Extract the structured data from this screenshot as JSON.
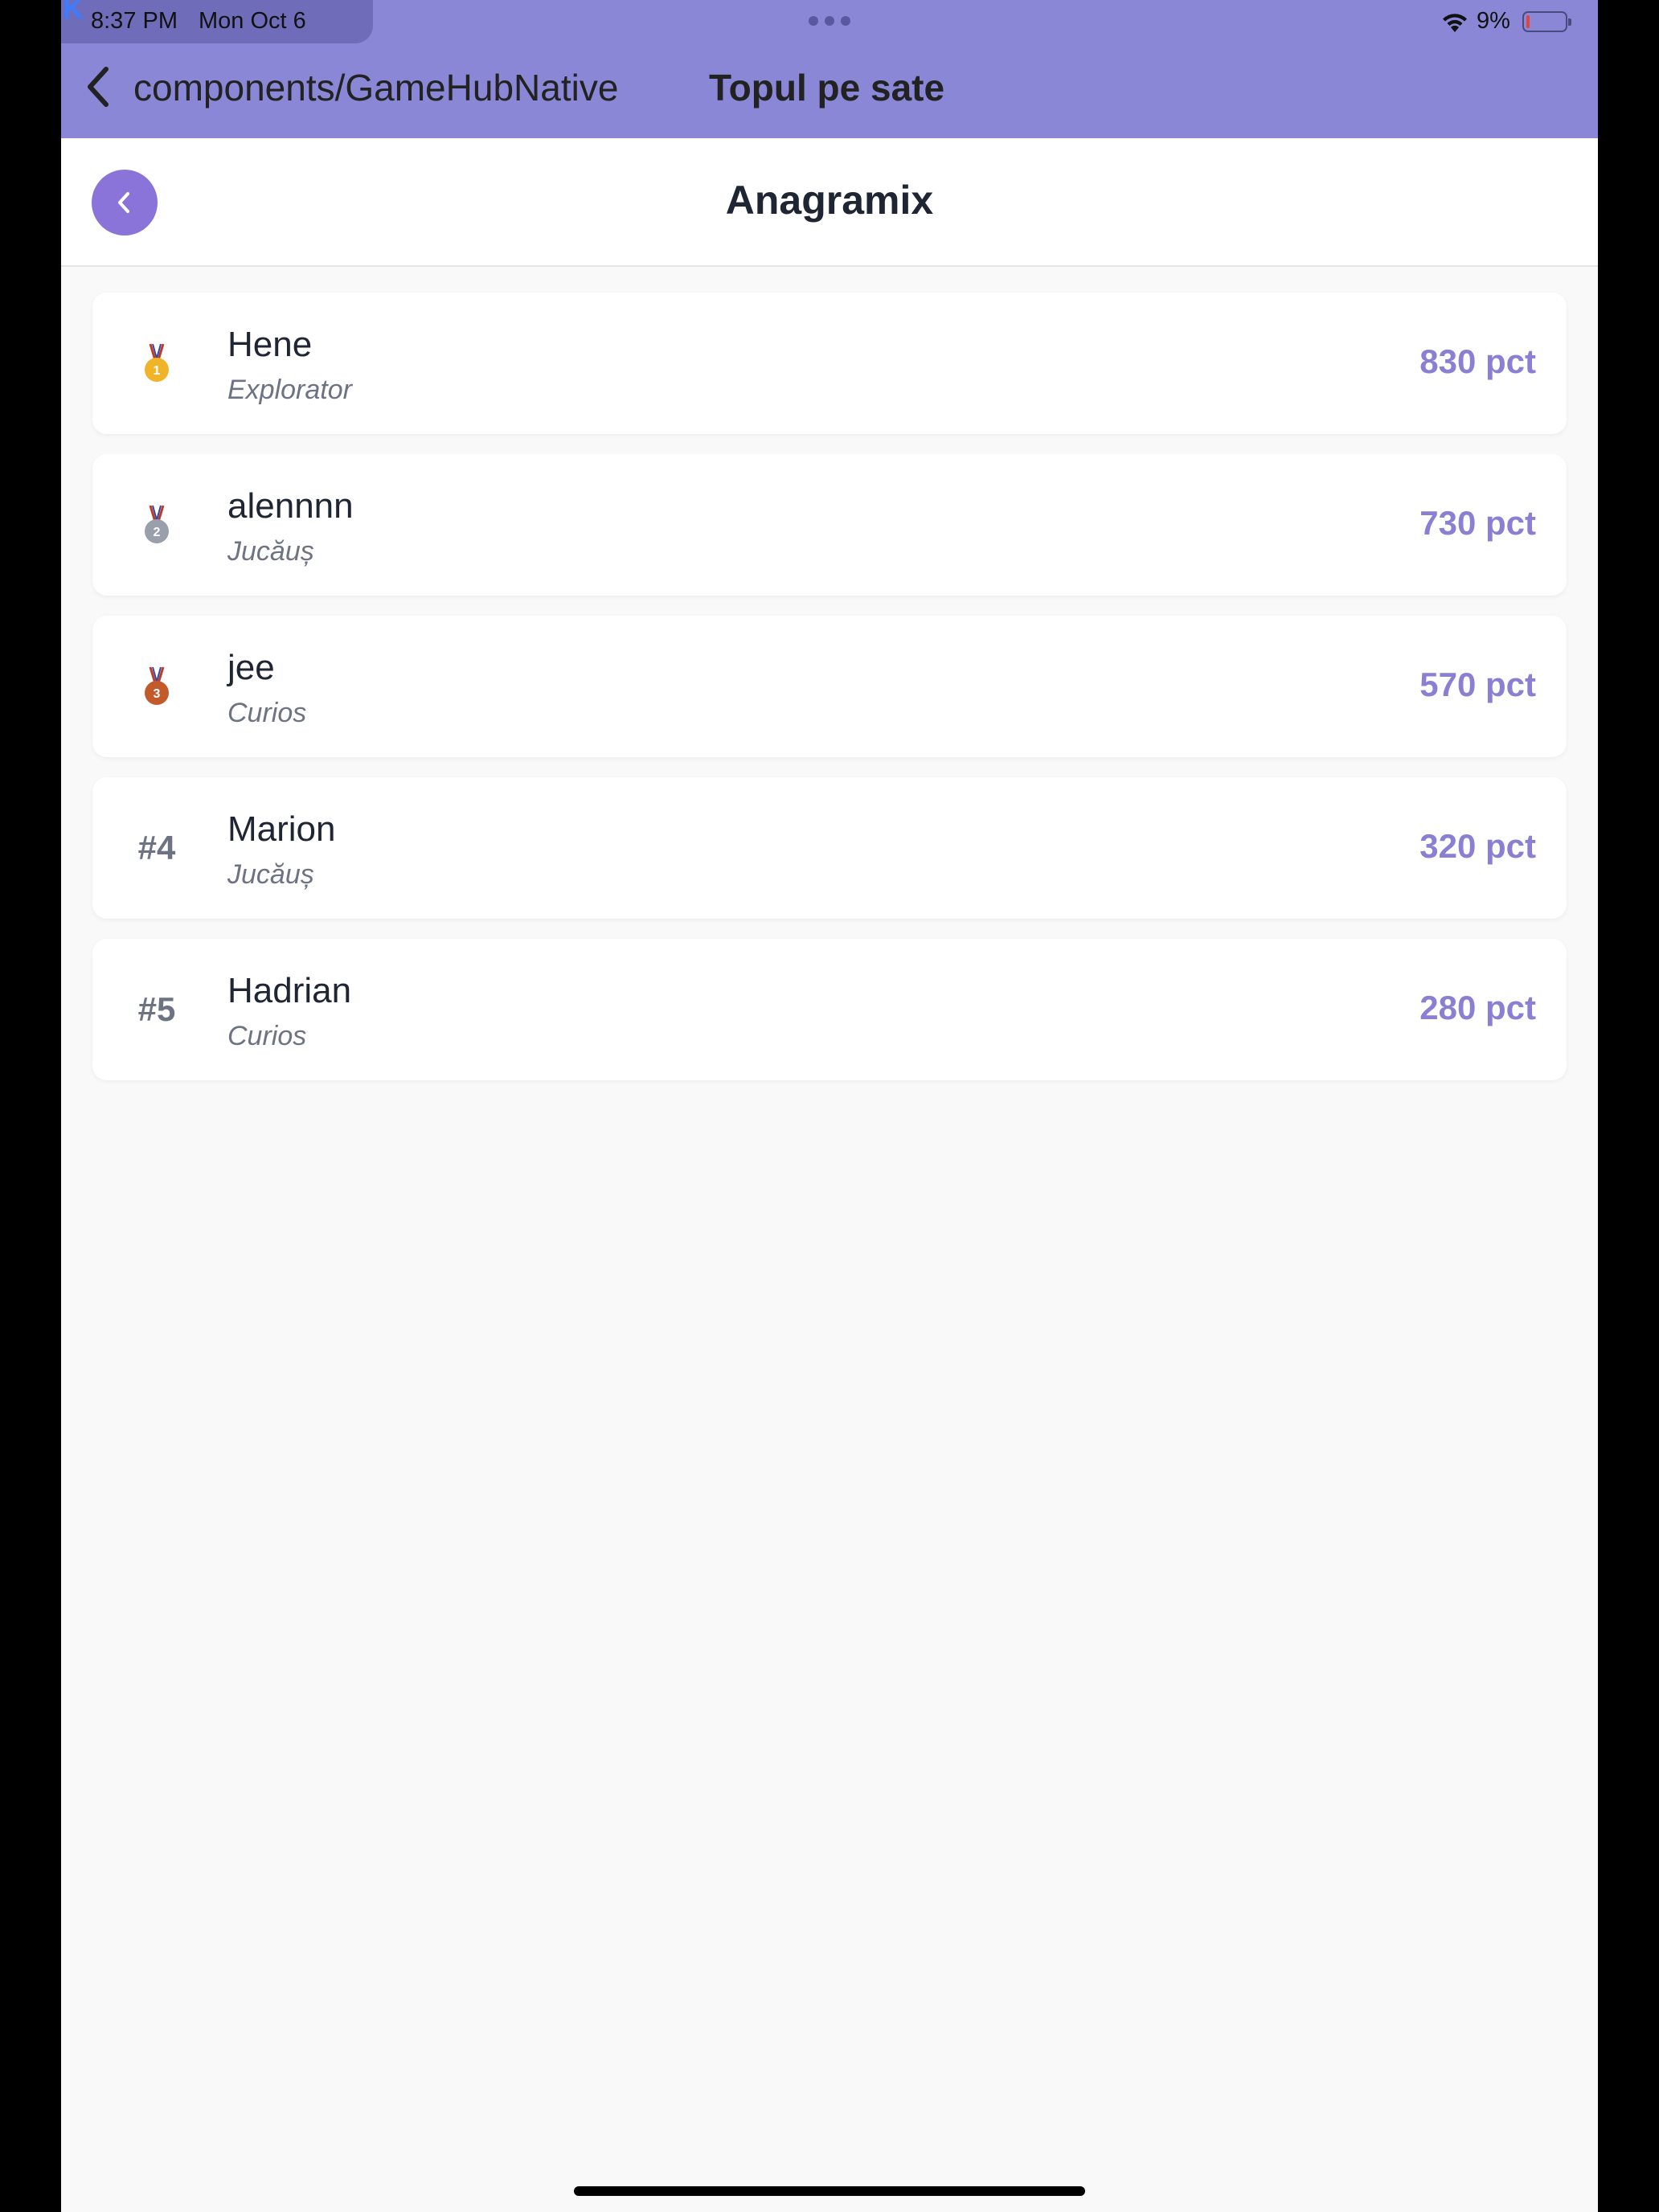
{
  "status_bar": {
    "app_corner_letter": "K",
    "time": "8:37 PM",
    "date": "Mon Oct 6",
    "battery": "9%"
  },
  "nav": {
    "back_label": "components/GameHubNative",
    "title": "Topul pe sate"
  },
  "page": {
    "title": "Anagramix"
  },
  "leaderboard": [
    {
      "rank": "1",
      "rank_label": "",
      "medal": "gold-medal-icon",
      "medal_color": "#f0b429",
      "name": "Hene",
      "title": "Explorator",
      "score": "830 pct"
    },
    {
      "rank": "2",
      "rank_label": "",
      "medal": "silver-medal-icon",
      "medal_color": "#9aa0ab",
      "name": "alennnn",
      "title": "Jucăuș",
      "score": "730 pct"
    },
    {
      "rank": "3",
      "rank_label": "",
      "medal": "bronze-medal-icon",
      "medal_color": "#c25a2c",
      "name": "jee",
      "title": "Curios",
      "score": "570 pct"
    },
    {
      "rank": "4",
      "rank_label": "#4",
      "medal": "",
      "name": "Marion",
      "title": "Jucăuș",
      "score": "320 pct"
    },
    {
      "rank": "5",
      "rank_label": "#5",
      "medal": "",
      "name": "Hadrian",
      "title": "Curios",
      "score": "280 pct"
    }
  ],
  "colors": {
    "header_bg": "#8987d6",
    "accent": "#8b74d9",
    "score": "#8b7fd4",
    "text_primary": "#1f2533",
    "text_secondary": "#6e7384"
  }
}
